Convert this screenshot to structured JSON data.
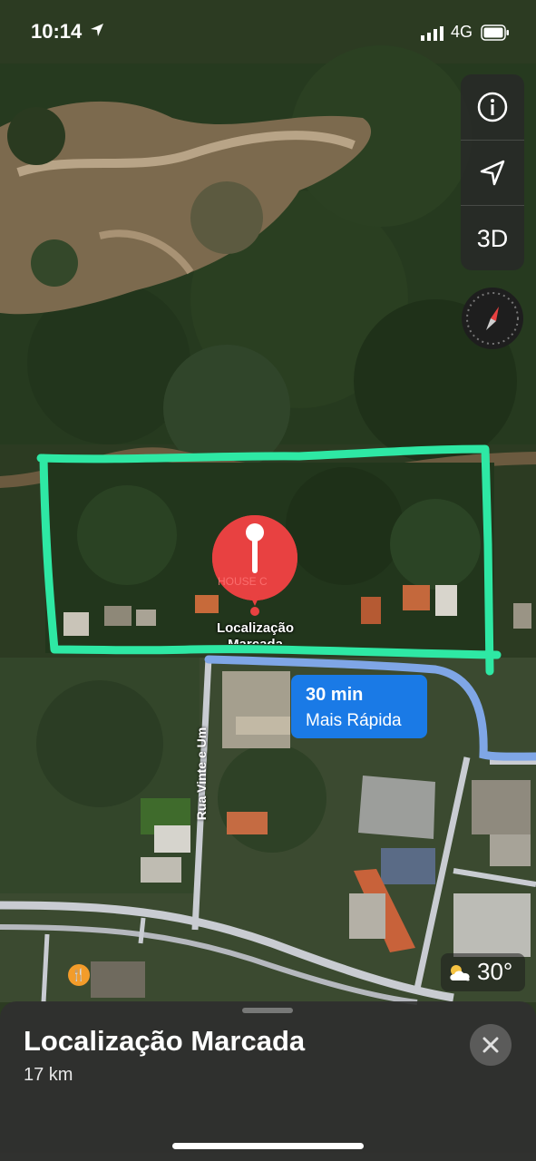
{
  "status_bar": {
    "time": "10:14",
    "network": "4G"
  },
  "map_controls": {
    "info_icon": "info-icon",
    "location_icon": "location-arrow-icon",
    "view_3d_label": "3D",
    "compass_icon": "compass-icon"
  },
  "marker": {
    "label": "Localização Marcada",
    "poi_text": "HOUSE C",
    "color": "#e84141"
  },
  "route": {
    "time": "30 min",
    "description": "Mais Rápida",
    "color": "#1a7ae6"
  },
  "map_labels": {
    "street": "Rua Vinte e Um"
  },
  "annotation": {
    "outline_color": "#2ee8a4"
  },
  "weather": {
    "temperature": "30°",
    "icon": "partly-cloudy-icon"
  },
  "bottom_sheet": {
    "title": "Localização Marcada",
    "distance": "17 km",
    "close_icon": "close-icon"
  }
}
